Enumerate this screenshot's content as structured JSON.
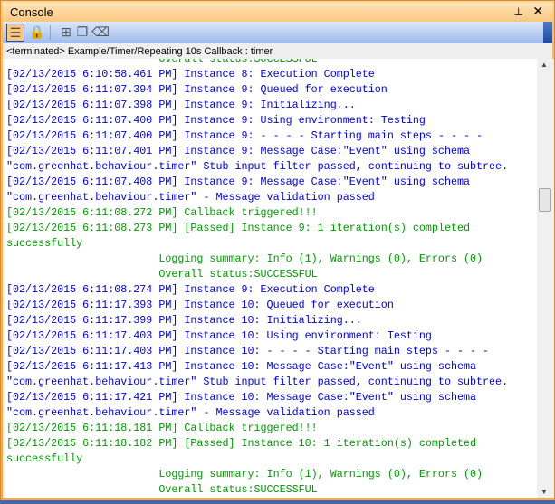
{
  "title": "Console",
  "icons": {
    "pin": "pin-icon",
    "close": "close-icon"
  },
  "toolbar": [
    {
      "name": "show-console-icon",
      "glyph": "☰",
      "active": true
    },
    {
      "name": "scroll-lock-icon",
      "glyph": "🔒",
      "active": false
    },
    {
      "name": "select-icon",
      "glyph": "⊞",
      "active": false
    },
    {
      "name": "copy-icon",
      "glyph": "❐",
      "active": false
    },
    {
      "name": "clear-icon",
      "glyph": "⌫",
      "active": false
    }
  ],
  "status": "<terminated> Example/Timer/Repeating 10s Callback : timer",
  "colors": {
    "blue": "#0000e0",
    "green": "#009900"
  },
  "lines": [
    {
      "c": "green",
      "t": "                        Overall status:SUCCESSFUL"
    },
    {
      "c": "blue",
      "t": "[02/13/2015 6:10:58.461 PM] Instance 8: Execution Complete"
    },
    {
      "c": "blue",
      "t": "[02/13/2015 6:11:07.394 PM] Instance 9: Queued for execution"
    },
    {
      "c": "blue",
      "t": "[02/13/2015 6:11:07.398 PM] Instance 9: Initializing..."
    },
    {
      "c": "blue",
      "t": "[02/13/2015 6:11:07.400 PM] Instance 9: Using environment: Testing"
    },
    {
      "c": "blue",
      "t": "[02/13/2015 6:11:07.400 PM] Instance 9: - - - - Starting main steps - - - -"
    },
    {
      "c": "blue",
      "t": "[02/13/2015 6:11:07.401 PM] Instance 9: Message Case:\"Event\" using schema"
    },
    {
      "c": "blue",
      "t": "\"com.greenhat.behaviour.timer\" Stub input filter passed, continuing to subtree."
    },
    {
      "c": "blue",
      "t": "[02/13/2015 6:11:07.408 PM] Instance 9: Message Case:\"Event\" using schema"
    },
    {
      "c": "blue",
      "t": "\"com.greenhat.behaviour.timer\" - Message validation passed"
    },
    {
      "c": "green",
      "t": "[02/13/2015 6:11:08.272 PM] Callback triggered!!!"
    },
    {
      "c": "green",
      "t": "[02/13/2015 6:11:08.273 PM] [Passed] Instance 9: 1 iteration(s) completed"
    },
    {
      "c": "green",
      "t": "successfully"
    },
    {
      "c": "green",
      "t": "                        Logging summary: Info (1), Warnings (0), Errors (0)"
    },
    {
      "c": "green",
      "t": "                        Overall status:SUCCESSFUL"
    },
    {
      "c": "blue",
      "t": "[02/13/2015 6:11:08.274 PM] Instance 9: Execution Complete"
    },
    {
      "c": "blue",
      "t": "[02/13/2015 6:11:17.393 PM] Instance 10: Queued for execution"
    },
    {
      "c": "blue",
      "t": "[02/13/2015 6:11:17.399 PM] Instance 10: Initializing..."
    },
    {
      "c": "blue",
      "t": "[02/13/2015 6:11:17.403 PM] Instance 10: Using environment: Testing"
    },
    {
      "c": "blue",
      "t": "[02/13/2015 6:11:17.403 PM] Instance 10: - - - - Starting main steps - - - -"
    },
    {
      "c": "blue",
      "t": "[02/13/2015 6:11:17.413 PM] Instance 10: Message Case:\"Event\" using schema"
    },
    {
      "c": "blue",
      "t": "\"com.greenhat.behaviour.timer\" Stub input filter passed, continuing to subtree."
    },
    {
      "c": "blue",
      "t": "[02/13/2015 6:11:17.421 PM] Instance 10: Message Case:\"Event\" using schema"
    },
    {
      "c": "blue",
      "t": "\"com.greenhat.behaviour.timer\" - Message validation passed"
    },
    {
      "c": "green",
      "t": "[02/13/2015 6:11:18.181 PM] Callback triggered!!!"
    },
    {
      "c": "green",
      "t": "[02/13/2015 6:11:18.182 PM] [Passed] Instance 10: 1 iteration(s) completed"
    },
    {
      "c": "green",
      "t": "successfully"
    },
    {
      "c": "green",
      "t": "                        Logging summary: Info (1), Warnings (0), Errors (0)"
    },
    {
      "c": "green",
      "t": "                        Overall status:SUCCESSFUL"
    }
  ]
}
